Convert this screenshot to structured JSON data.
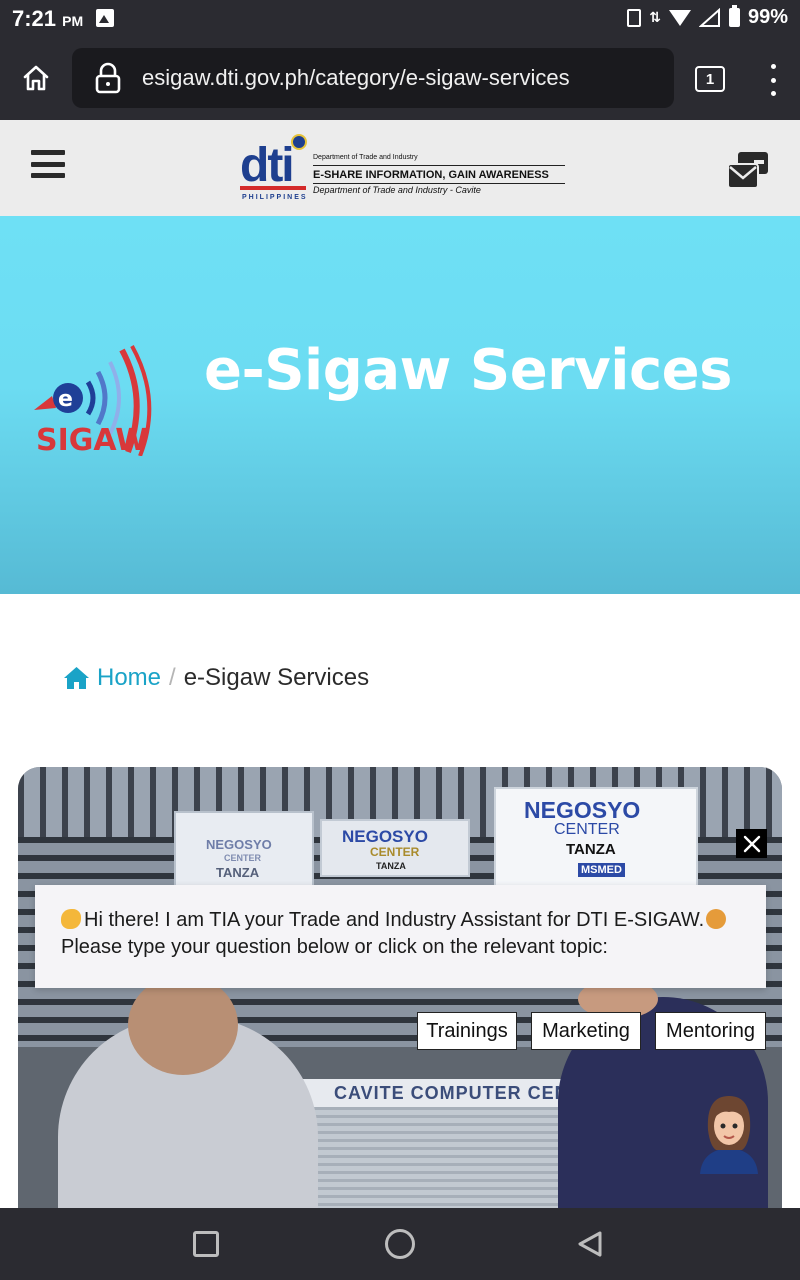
{
  "status_bar": {
    "time": "7:21",
    "ampm": "PM",
    "battery": "99%"
  },
  "browser": {
    "url": "esigaw.dti.gov.ph/category/e-sigaw-services",
    "tab_count": "1"
  },
  "site_header": {
    "logo": {
      "mark": "dti",
      "country": "PHILIPPINES",
      "department": "Department of Trade and Industry",
      "tagline": "E-SHARE INFORMATION, GAIN AWARENESS",
      "subtitle": "Department of Trade and Industry - Cavite"
    }
  },
  "hero": {
    "logo_text": "SIGAW",
    "title": "e-Sigaw Services"
  },
  "breadcrumb": {
    "home": "Home",
    "separator": "/",
    "current": "e-Sigaw Services"
  },
  "photo": {
    "sign_small_line1": "NEGOSYO",
    "sign_small_line2": "CENTER",
    "sign_small_line3": "TANZA",
    "sign_mid_line1": "NEGOSYO",
    "sign_mid_line2": "CENTER",
    "sign_mid_line3": "TANZA",
    "sign_big_line1": "NEGOSYO",
    "sign_big_line2": "CENTER",
    "sign_big_line3": "TANZA",
    "sign_big_line4": "MSMED",
    "building_sign": "CAVITE COMPUTER CENTER"
  },
  "chat": {
    "line1": "Hi there! I am TIA your Trade and Industry Assistant for DTI E-SIGAW.",
    "line2": "Please type your question below or click on the relevant topic:",
    "topics": [
      "Trainings",
      "Marketing",
      "Mentoring"
    ]
  },
  "colors": {
    "hero_top": "#6ee0f5",
    "hero_bottom": "#56bad4",
    "link": "#1aa3c7",
    "dark_bar": "#2b2b31"
  }
}
